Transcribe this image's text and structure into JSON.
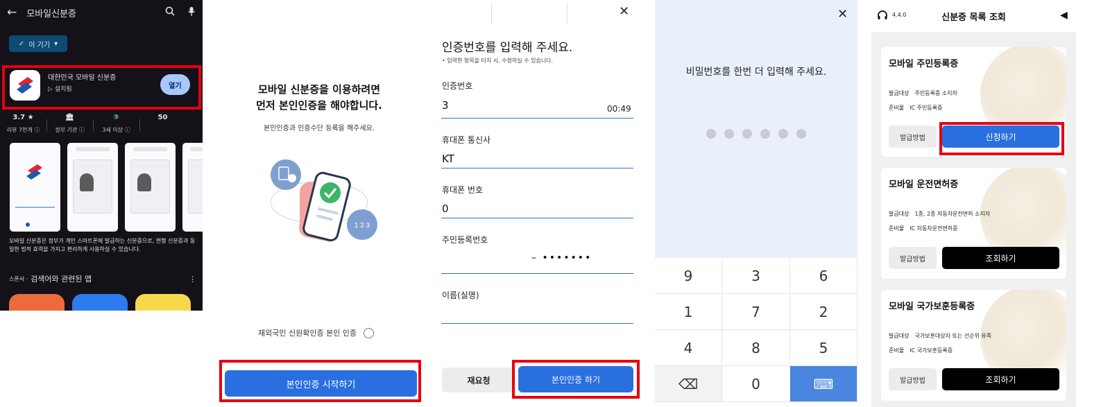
{
  "play_store": {
    "search_text": "모바일신분증",
    "device_chip": "이 기기",
    "app_name": "대한민국 모바일 신분증",
    "installed": "설치됨",
    "open_button": "열기",
    "stats": [
      {
        "value": "3.7 ★",
        "label": "리뷰 7천개 ⓘ"
      },
      {
        "value": "🏛",
        "label": "정부 기관 ⓘ"
      },
      {
        "value": "③",
        "label": "3세 이상 ⓘ"
      },
      {
        "value": "50",
        "label": ""
      }
    ],
    "description": "모바일 신분증은 정부가 개인 스마트폰에 발급하는 신분증으로, 현행 신분증과 동일한 법적 효력을 가지고 편리하게 사용하실 수 있습니다.",
    "related_sponsor": "스폰서 ·",
    "related_title": "검색어와 관련된 앱"
  },
  "intro": {
    "title_line1": "모바일 신분증을 이용하려면",
    "title_line2": "먼저 본인인증을 해야합니다.",
    "subtitle": "본인인증과 인증수단 등록을 해주세요.",
    "badge_number": "1 2 3",
    "foreign_option": "재외국민 신원확인증 본인 인증",
    "start_button": "본인인증 시작하기"
  },
  "verify_form": {
    "heading": "인증번호를 입력해 주세요.",
    "hint": "• 입력한 항목을 터치 시, 수정하실 수 있습니다.",
    "code_label": "인증번호",
    "code_value": "3",
    "timer": "00:49",
    "carrier_label": "휴대폰 통신사",
    "carrier_value": "KT",
    "phone_label": "휴대폰 번호",
    "phone_value": "0",
    "rrn_label": "주민등록번호",
    "rrn_value": "–   •••••••",
    "name_label": "이름(실명)",
    "retry_button": "재요청",
    "verify_button": "본인인증 하기"
  },
  "pin_pad": {
    "prompt": "비밀번호를 한번 더 입력해 주세요.",
    "keys": [
      "9",
      "3",
      "6",
      "1",
      "7",
      "2",
      "4",
      "8",
      "5",
      "⌫",
      "0",
      "⌨"
    ]
  },
  "id_list": {
    "version": "4.4.0",
    "title": "신분증 목록 조회",
    "issue_target_label": "발급대상",
    "required_label": "준비물",
    "how_button": "발급방법",
    "cards": [
      {
        "name": "모바일 주민등록증",
        "target": "주민등록증 소지자",
        "required": "IC 주민등록증",
        "action": "신청하기"
      },
      {
        "name": "모바일 운전면허증",
        "target": "1종, 2종 자동차운전면허 소지자",
        "required": "IC 자동차운전면허증",
        "action": "조회하기"
      },
      {
        "name": "모바일 국가보훈등록증",
        "target": "국가보훈대상자 또는 선순위 유족",
        "required": "IC 국가보훈등록증",
        "action": "조회하기"
      }
    ]
  },
  "colors": {
    "accent_blue": "#2a6fe0",
    "highlight_red": "#e60012"
  }
}
